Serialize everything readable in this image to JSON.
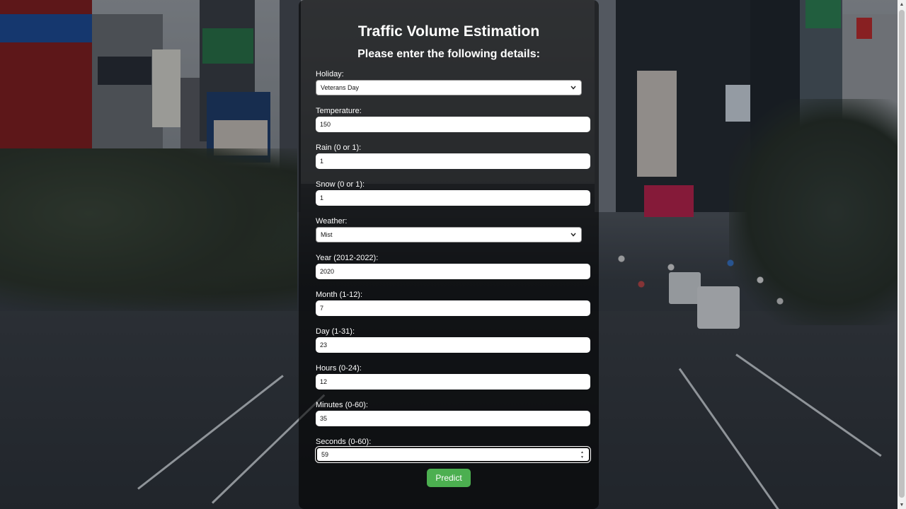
{
  "form": {
    "title": "Traffic Volume Estimation",
    "subtitle": "Please enter the following details:",
    "fields": [
      {
        "label": "Holiday:",
        "value": "Veterans Day",
        "type": "select"
      },
      {
        "label": "Temperature:",
        "value": "150",
        "type": "input"
      },
      {
        "label": "Rain (0 or 1):",
        "value": "1",
        "type": "input"
      },
      {
        "label": "Snow (0 or 1):",
        "value": "1",
        "type": "input"
      },
      {
        "label": "Weather:",
        "value": "Mist",
        "type": "select"
      },
      {
        "label": "Year (2012-2022):",
        "value": "2020",
        "type": "input"
      },
      {
        "label": "Month (1-12):",
        "value": "7",
        "type": "input"
      },
      {
        "label": "Day (1-31):",
        "value": "23",
        "type": "input"
      },
      {
        "label": "Hours (0-24):",
        "value": "12",
        "type": "input"
      },
      {
        "label": "Minutes (0-60):",
        "value": "35",
        "type": "input"
      },
      {
        "label": "Seconds (0-60):",
        "value": "59",
        "type": "input",
        "focused": true
      }
    ],
    "submit_label": "Predict"
  },
  "colors": {
    "accent": "#4caf50",
    "panel": "rgba(0,0,0,0.58)",
    "text": "#ffffff"
  },
  "icons": {
    "select_arrow": "chevron-down-icon",
    "number_spinner": "spinner-icon"
  }
}
